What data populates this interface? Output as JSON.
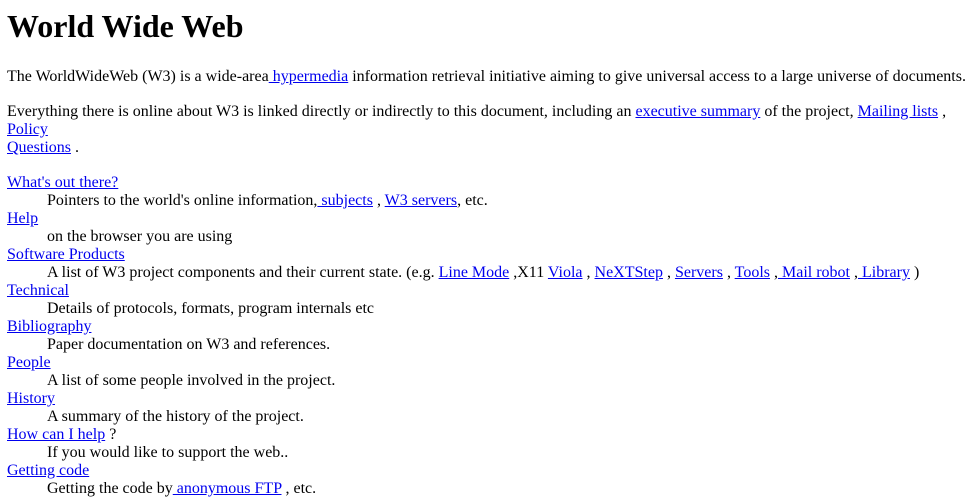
{
  "page": {
    "title": "World Wide Web"
  },
  "intro": {
    "prefix": "The WorldWideWeb (W3) is a wide-area",
    "hypermedia_link": " hypermedia",
    "suffix": " information retrieval initiative aiming to give universal access to a large universe of documents."
  },
  "second": {
    "prefix": "Everything there is online about W3 is linked directly or indirectly to this document, including an ",
    "summary_link": "executive summary",
    "mid1": " of the project, ",
    "mailing_link": "Mailing lists",
    "mid2": " , ",
    "policy_link": "Policy",
    "questions_link": "Questions",
    "end": " ."
  },
  "list": {
    "whats_out": {
      "term": "What's out there?",
      "desc_prefix": "Pointers to the world's online information,",
      "subjects_link": " subjects",
      "desc_mid": " , ",
      "servers_link": "W3 servers",
      "desc_end": ", etc."
    },
    "help": {
      "term": "Help",
      "desc": "on the browser you are using"
    },
    "software": {
      "term": "Software Products",
      "desc_prefix": "A list of W3 project components and their current state. (e.g. ",
      "line_mode_link": "Line Mode",
      "x11_text": " ,X11 ",
      "viola_link": "Viola",
      "sep1": " , ",
      "nextstep_link": "NeXTStep",
      "sep2": " , ",
      "servers_link": "Servers",
      "sep3": " , ",
      "tools_link": "Tools",
      "sep4": " ,",
      "mail_robot_link": " Mail robot",
      "sep5": " ,",
      "library_link": " Library",
      "desc_end": " )"
    },
    "technical": {
      "term": "Technical",
      "desc": "Details of protocols, formats, program internals etc"
    },
    "bibliography": {
      "term": "Bibliography",
      "desc": "Paper documentation on W3 and references."
    },
    "people": {
      "term": "People",
      "desc": "A list of some people involved in the project."
    },
    "history": {
      "term": "History",
      "desc": "A summary of the history of the project."
    },
    "how_help": {
      "term": "How can I help",
      "term_suffix": " ?",
      "desc": "If you would like to support the web.."
    },
    "getting_code": {
      "term": "Getting code",
      "desc_prefix": "Getting the code by",
      "ftp_link": " anonymous FTP",
      "desc_end": " , etc."
    }
  }
}
